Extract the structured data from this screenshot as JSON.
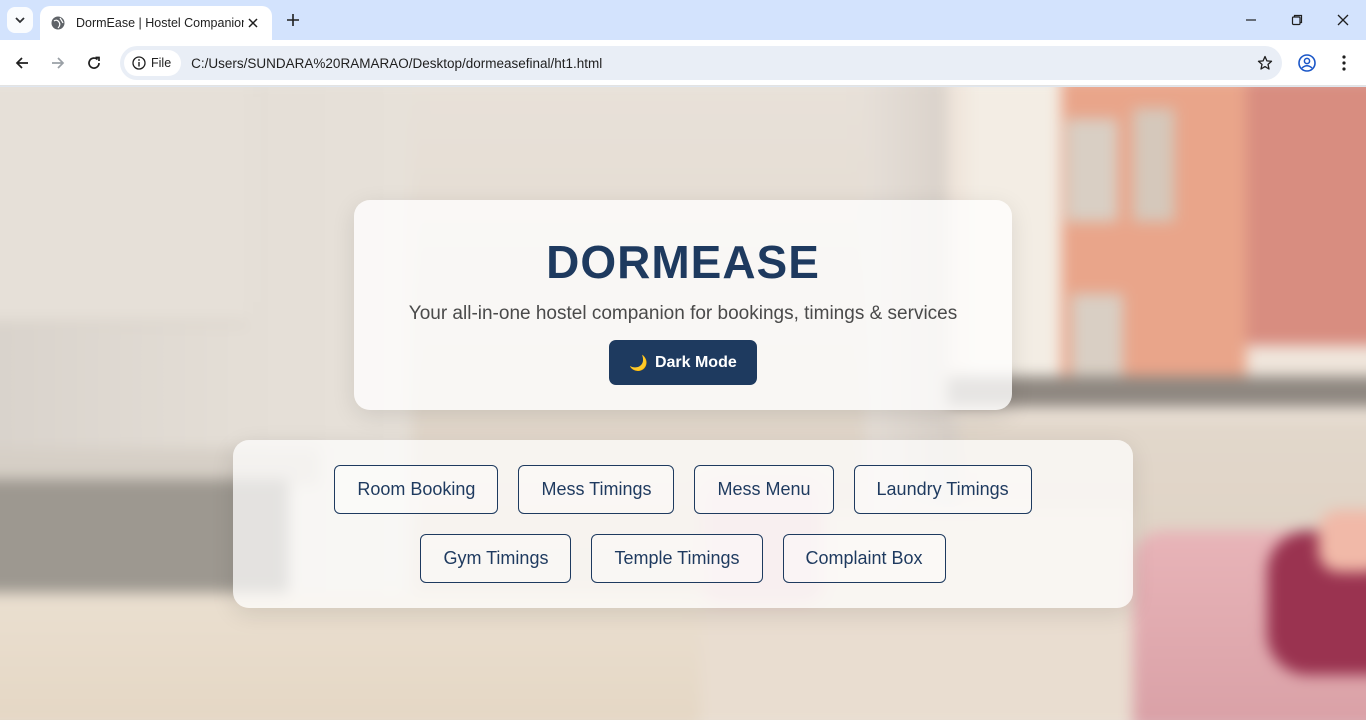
{
  "browser": {
    "tab_title": "DormEase | Hostel Companion",
    "site_chip_label": "File",
    "url": "C:/Users/SUNDARA%20RAMARAO/Desktop/dormeasefinal/ht1.html"
  },
  "hero": {
    "title": "DORMEASE",
    "subtitle": "Your all-in-one hostel companion for bookings, timings & services",
    "dark_mode_icon": "🌙",
    "dark_mode_label": "Dark Mode"
  },
  "menu": {
    "row1": [
      "Room Booking",
      "Mess Timings",
      "Mess Menu",
      "Laundry Timings"
    ],
    "row2": [
      "Gym Timings",
      "Temple Timings",
      "Complaint Box"
    ]
  },
  "colors": {
    "primary": "#1e3a5f",
    "tabbar": "#d3e3fd"
  }
}
